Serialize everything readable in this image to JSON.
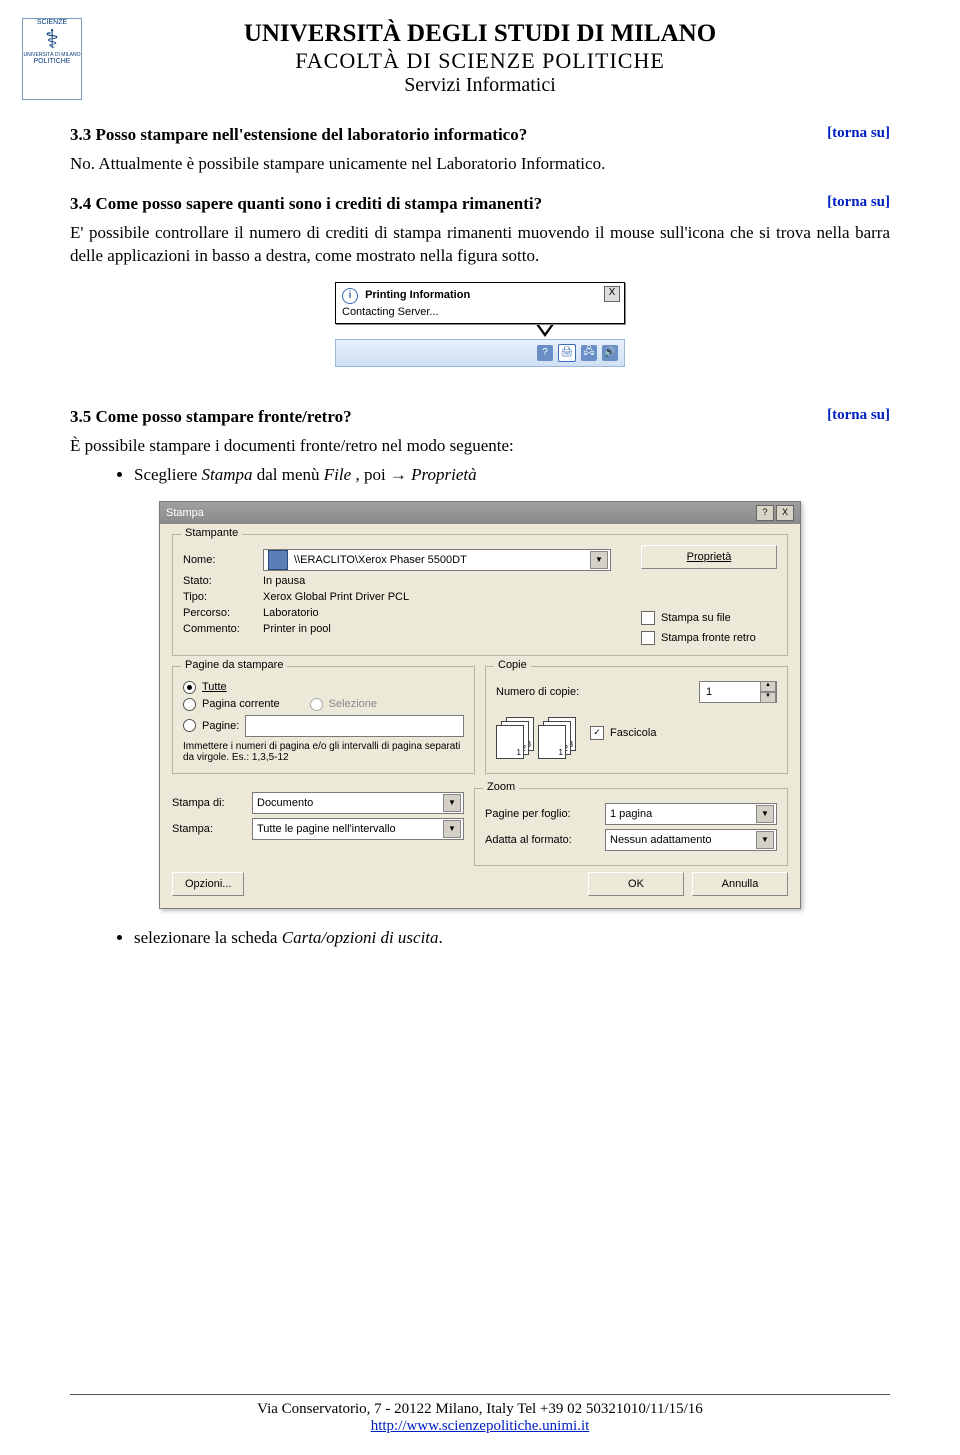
{
  "header": {
    "university": "UNIVERSITÀ DEGLI STUDI DI MILANO",
    "faculty": "FACOLTÀ DI SCIENZE POLITICHE",
    "service": "Servizi Informatici",
    "logo_top": "SCIENZE",
    "logo_bottom": "POLITICHE",
    "logo_uni": "UNIVERSITÀ DI MILANO"
  },
  "links": {
    "torna_su": "[torna su]"
  },
  "s33": {
    "title": "3.3 Posso stampare nell'estensione del laboratorio informatico?",
    "text": "No. Attualmente è possibile stampare unicamente nel Laboratorio Informatico."
  },
  "s34": {
    "title": "3.4 Come posso sapere quanti sono i crediti di stampa rimanenti?",
    "text": "E' possibile controllare il numero di crediti di stampa rimanenti muovendo il mouse sull'icona che si trova nella barra delle applicazioni in basso a destra, come mostrato nella figura sotto."
  },
  "fig1": {
    "tooltip_title": "Printing Information",
    "tooltip_text": "Contacting Server...",
    "close": "X"
  },
  "s35": {
    "title": "3.5 Come posso stampare fronte/retro?",
    "intro": "È possibile stampare i documenti fronte/retro nel modo seguente:",
    "bullet1_a": "Scegliere ",
    "bullet1_b": "Stampa",
    "bullet1_c": " dal menù ",
    "bullet1_d": "File",
    "bullet1_e": " , poi → ",
    "bullet1_f": "Proprietà",
    "bullet2_a": "selezionare la scheda ",
    "bullet2_b": "Carta/opzioni di uscita",
    "bullet2_c": "."
  },
  "dlg": {
    "title": "Stampa",
    "help": "?",
    "close": "X",
    "grp_printer": "Stampante",
    "lbl_nome": "Nome:",
    "printer_name": "\\\\ERACLITO\\Xerox Phaser 5500DT",
    "btn_proprieta": "Proprietà",
    "lbl_stato": "Stato:",
    "val_stato": "In pausa",
    "lbl_tipo": "Tipo:",
    "val_tipo": "Xerox Global Print Driver PCL",
    "lbl_percorso": "Percorso:",
    "val_percorso": "Laboratorio",
    "lbl_commento": "Commento:",
    "val_commento": "Printer in pool",
    "chk_stampa_file": "Stampa su file",
    "chk_fronte_retro": "Stampa fronte retro",
    "grp_pagine": "Pagine da stampare",
    "r_tutte": "Tutte",
    "r_corrente": "Pagina corrente",
    "r_selezione": "Selezione",
    "r_pagine": "Pagine:",
    "pagine_help": "Immettere i numeri di pagina e/o gli intervalli di pagina separati da virgole. Es.: 1,3,5-12",
    "grp_copie": "Copie",
    "lbl_numcopie": "Numero di copie:",
    "val_numcopie": "1",
    "chk_fascicola": "Fascicola",
    "lbl_stampa_di": "Stampa di:",
    "val_stampa_di": "Documento",
    "lbl_stampa": "Stampa:",
    "val_stampa": "Tutte le pagine nell'intervallo",
    "grp_zoom": "Zoom",
    "lbl_ppf": "Pagine per foglio:",
    "val_ppf": "1 pagina",
    "lbl_adatta": "Adatta al formato:",
    "val_adatta": "Nessun adattamento",
    "btn_opzioni": "Opzioni...",
    "btn_ok": "OK",
    "btn_annulla": "Annulla"
  },
  "footer": {
    "line1": "Via Conservatorio, 7 - 20122 Milano, Italy  Tel +39 02 50321010/11/15/16",
    "url": "http://www.scienzepolitiche.unimi.it"
  }
}
